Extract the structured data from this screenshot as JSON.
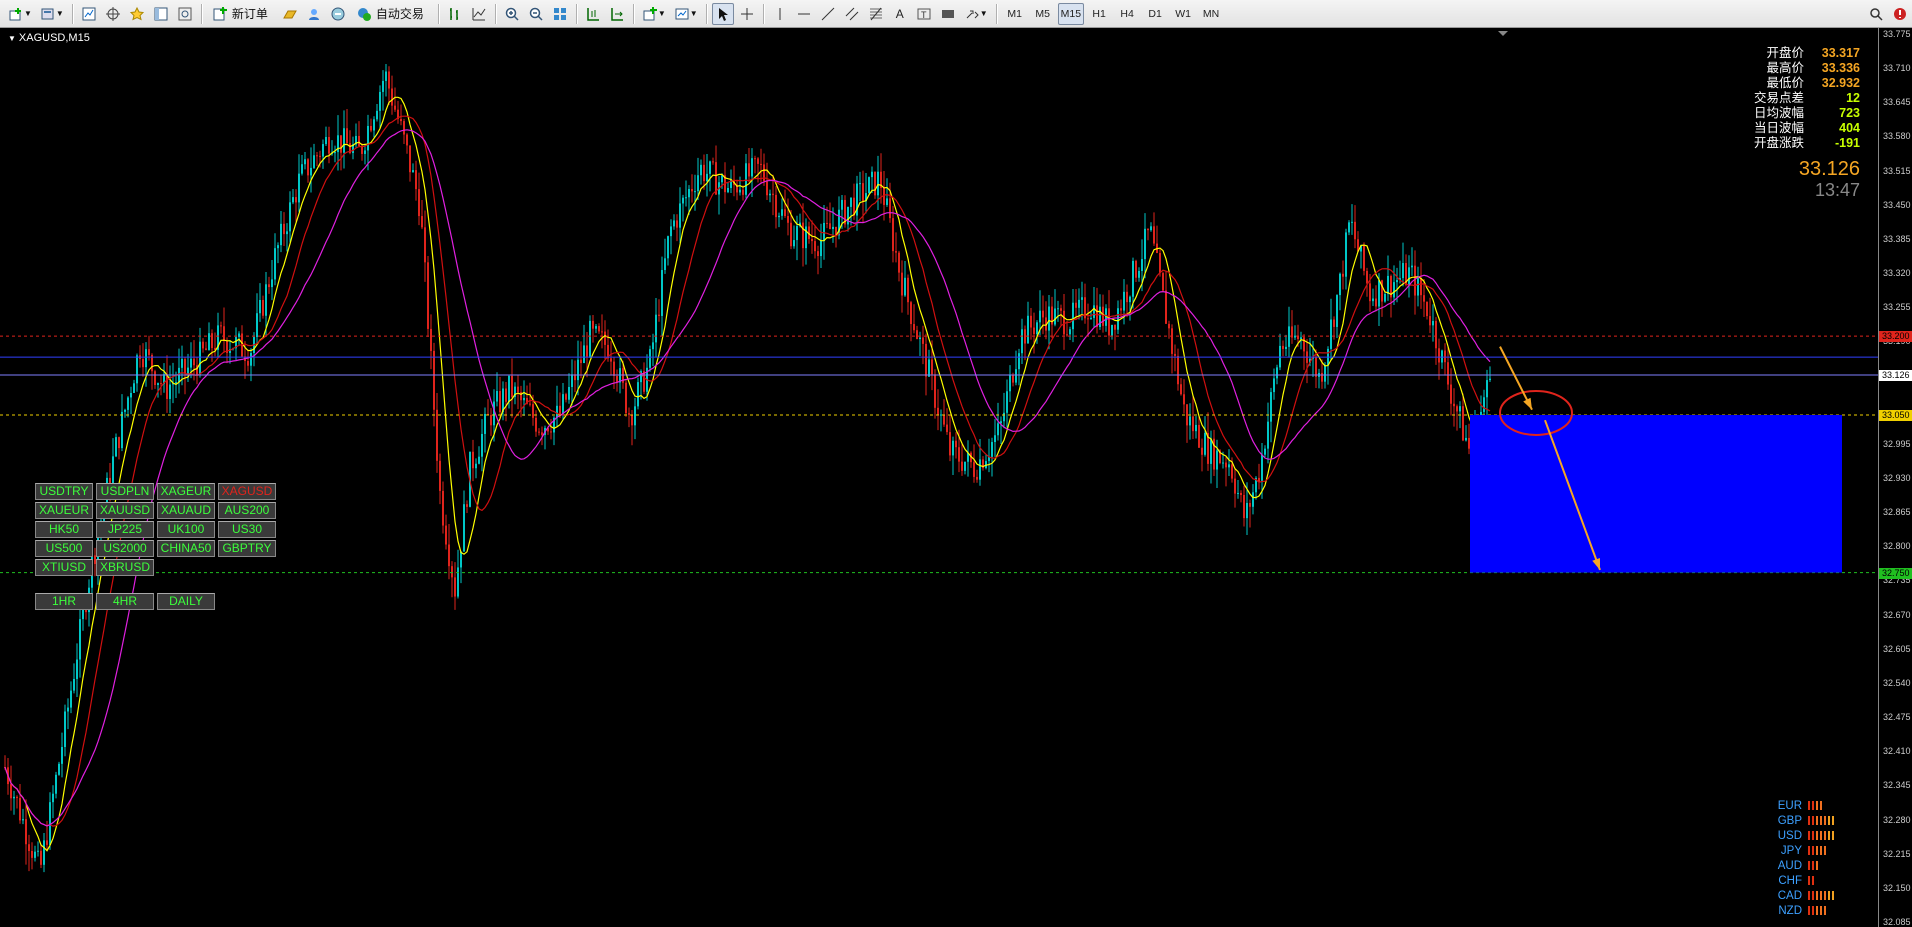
{
  "toolbar": {
    "buttons_left": [
      {
        "name": "new-chart-icon",
        "interact": true
      },
      {
        "name": "profiles-icon",
        "interact": true
      },
      {
        "name": "market-watch-icon",
        "interact": true
      },
      {
        "name": "navigator-icon",
        "interact": true
      },
      {
        "name": "favorites-icon",
        "interact": true
      },
      {
        "name": "data-window-icon",
        "interact": true
      },
      {
        "name": "tester-icon",
        "interact": true
      }
    ],
    "new_order_label": "新订单",
    "auto_trading_label": "自动交易",
    "timeframes": [
      "M1",
      "M5",
      "M15",
      "H1",
      "H4",
      "D1",
      "W1",
      "MN"
    ],
    "active_timeframe": "M15"
  },
  "chart": {
    "title": "XAGUSD,M15",
    "price_ticks": [
      "33.775",
      "33.710",
      "33.645",
      "33.580",
      "33.515",
      "33.450",
      "33.385",
      "33.320",
      "33.255",
      "33.190",
      "33.126",
      "33.050",
      "32.995",
      "32.930",
      "32.865",
      "32.800",
      "32.735",
      "32.670",
      "32.605",
      "32.540",
      "32.475",
      "32.410",
      "32.345",
      "32.280",
      "32.215",
      "32.150",
      "32.085"
    ],
    "tags": {
      "red_line": "33.200",
      "current": "33.126",
      "yellow_line": "33.050",
      "green_line": "32.750"
    },
    "colors": {
      "bull": "#00c8c8",
      "bear": "#e0241c",
      "ma_fast": "#ffff00",
      "ma_mid": "#d01010",
      "ma_slow": "#e020e0",
      "zone": "#0000ff",
      "arrow": "#f5a623"
    }
  },
  "info": {
    "rows": [
      {
        "label": "开盘价",
        "value": "33.317",
        "color": "#f5a623"
      },
      {
        "label": "最高价",
        "value": "33.336",
        "color": "#f5a623"
      },
      {
        "label": "最低价",
        "value": "32.932",
        "color": "#f5a623"
      },
      {
        "label": "交易点差",
        "value": "12",
        "color": "#c8ff00"
      },
      {
        "label": "日均波幅",
        "value": "723",
        "color": "#c8ff00"
      },
      {
        "label": "当日波幅",
        "value": "404",
        "color": "#c8ff00"
      },
      {
        "label": "开盘涨跌",
        "value": "-191",
        "color": "#c8ff00"
      }
    ],
    "price": "33.126",
    "time": "13:47"
  },
  "symbols": [
    [
      "USDTRY",
      "USDPLN",
      "XAGEUR",
      "XAGUSD"
    ],
    [
      "XAUEUR",
      "XAUUSD",
      "XAUAUD",
      "AUS200"
    ],
    [
      "HK50",
      "JP225",
      "UK100",
      "US30"
    ],
    [
      "US500",
      "US2000",
      "CHINA50",
      "GBPTRY"
    ],
    [
      "XTIUSD",
      "XBRUSD"
    ]
  ],
  "active_symbol": "XAGUSD",
  "periods": [
    "1HR",
    "4HR",
    "DAILY"
  ],
  "strength": [
    {
      "currency": "EUR",
      "level": 4
    },
    {
      "currency": "GBP",
      "level": 7
    },
    {
      "currency": "USD",
      "level": 7
    },
    {
      "currency": "JPY",
      "level": 5
    },
    {
      "currency": "AUD",
      "level": 3
    },
    {
      "currency": "CHF",
      "level": 2
    },
    {
      "currency": "CAD",
      "level": 7
    },
    {
      "currency": "NZD",
      "level": 5
    }
  ]
}
